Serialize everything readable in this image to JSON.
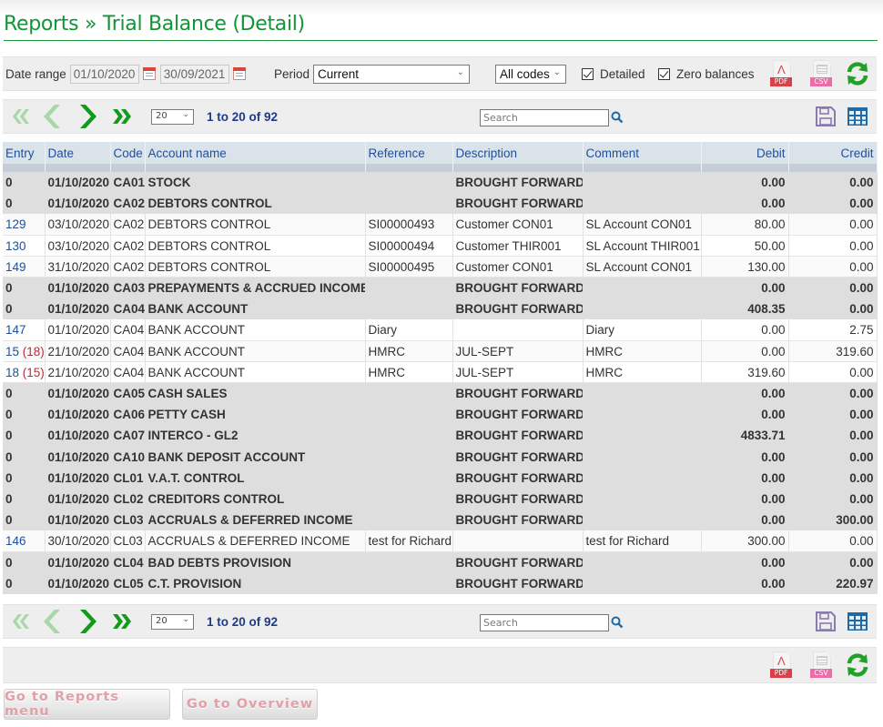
{
  "page": {
    "title": "Reports » Trial Balance (Detail)"
  },
  "filters": {
    "date_range_label": "Date range",
    "date_from": "01/10/2020",
    "date_to": "30/09/2021",
    "period_label": "Period",
    "period_value": "Current",
    "codes_value": "All codes",
    "detailed_label": "Detailed",
    "detailed_checked": true,
    "zero_balances_label": "Zero balances",
    "zero_balances_checked": true,
    "pdf_label": "PDF",
    "csv_label": "CSV"
  },
  "pager": {
    "page_size": "20",
    "count_text": "1 to 20 of 92",
    "search_placeholder": "Search"
  },
  "colors": {
    "brand_green": "#13943a",
    "header_blue": "#1f4f9a",
    "pdf_red": "#d6424c",
    "csv_pink": "#e86ea8"
  },
  "table": {
    "columns": [
      "Entry",
      "Date",
      "Code",
      "Account name",
      "Reference",
      "Description",
      "Comment",
      "Debit",
      "Credit"
    ],
    "rows": [
      {
        "type": "bf",
        "entry": "0",
        "entry_ref": "",
        "date": "01/10/2020",
        "code": "CA01",
        "account": "STOCK",
        "reference": "",
        "description": "BROUGHT FORWARD",
        "comment": "",
        "debit": "0.00",
        "credit": "0.00"
      },
      {
        "type": "bf",
        "entry": "0",
        "entry_ref": "",
        "date": "01/10/2020",
        "code": "CA02",
        "account": "DEBTORS CONTROL",
        "reference": "",
        "description": "BROUGHT FORWARD",
        "comment": "",
        "debit": "0.00",
        "credit": "0.00"
      },
      {
        "type": "tx",
        "entry": "129",
        "entry_ref": "",
        "date": "03/10/2020",
        "code": "CA02",
        "account": "DEBTORS CONTROL",
        "reference": "SI00000493",
        "description": "Customer CON01",
        "comment": "SL Account CON01",
        "debit": "80.00",
        "credit": "0.00"
      },
      {
        "type": "tx",
        "entry": "130",
        "entry_ref": "",
        "date": "03/10/2020",
        "code": "CA02",
        "account": "DEBTORS CONTROL",
        "reference": "SI00000494",
        "description": "Customer THIR001",
        "comment": "SL Account THIR001",
        "debit": "50.00",
        "credit": "0.00"
      },
      {
        "type": "tx",
        "entry": "149",
        "entry_ref": "",
        "date": "31/10/2020",
        "code": "CA02",
        "account": "DEBTORS CONTROL",
        "reference": "SI00000495",
        "description": "Customer CON01",
        "comment": "SL Account CON01",
        "debit": "130.00",
        "credit": "0.00"
      },
      {
        "type": "bf",
        "entry": "0",
        "entry_ref": "",
        "date": "01/10/2020",
        "code": "CA03",
        "account": "PREPAYMENTS & ACCRUED INCOME",
        "reference": "",
        "description": "BROUGHT FORWARD",
        "comment": "",
        "debit": "0.00",
        "credit": "0.00"
      },
      {
        "type": "bf",
        "entry": "0",
        "entry_ref": "",
        "date": "01/10/2020",
        "code": "CA04",
        "account": "BANK ACCOUNT",
        "reference": "",
        "description": "BROUGHT FORWARD",
        "comment": "",
        "debit": "408.35",
        "credit": "0.00"
      },
      {
        "type": "tx",
        "entry": "147",
        "entry_ref": "",
        "date": "01/10/2020",
        "code": "CA04",
        "account": "BANK ACCOUNT",
        "reference": "Diary",
        "description": "",
        "comment": "Diary",
        "debit": "0.00",
        "credit": "2.75"
      },
      {
        "type": "tx",
        "entry": "15",
        "entry_ref": "(18)",
        "date": "21/10/2020",
        "code": "CA04",
        "account": "BANK ACCOUNT",
        "reference": "HMRC",
        "description": "JUL-SEPT",
        "comment": "HMRC",
        "debit": "0.00",
        "credit": "319.60"
      },
      {
        "type": "tx",
        "entry": "18",
        "entry_ref": "(15)",
        "date": "21/10/2020",
        "code": "CA04",
        "account": "BANK ACCOUNT",
        "reference": "HMRC",
        "description": "JUL-SEPT",
        "comment": "HMRC",
        "debit": "319.60",
        "credit": "0.00"
      },
      {
        "type": "bf",
        "entry": "0",
        "entry_ref": "",
        "date": "01/10/2020",
        "code": "CA05",
        "account": "CASH SALES",
        "reference": "",
        "description": "BROUGHT FORWARD",
        "comment": "",
        "debit": "0.00",
        "credit": "0.00"
      },
      {
        "type": "bf",
        "entry": "0",
        "entry_ref": "",
        "date": "01/10/2020",
        "code": "CA06",
        "account": "PETTY CASH",
        "reference": "",
        "description": "BROUGHT FORWARD",
        "comment": "",
        "debit": "0.00",
        "credit": "0.00"
      },
      {
        "type": "bf",
        "entry": "0",
        "entry_ref": "",
        "date": "01/10/2020",
        "code": "CA07",
        "account": "INTERCO - GL2",
        "reference": "",
        "description": "BROUGHT FORWARD",
        "comment": "",
        "debit": "4833.71",
        "credit": "0.00"
      },
      {
        "type": "bf",
        "entry": "0",
        "entry_ref": "",
        "date": "01/10/2020",
        "code": "CA10",
        "account": "BANK DEPOSIT ACCOUNT",
        "reference": "",
        "description": "BROUGHT FORWARD",
        "comment": "",
        "debit": "0.00",
        "credit": "0.00"
      },
      {
        "type": "bf",
        "entry": "0",
        "entry_ref": "",
        "date": "01/10/2020",
        "code": "CL01",
        "account": "V.A.T. CONTROL",
        "reference": "",
        "description": "BROUGHT FORWARD",
        "comment": "",
        "debit": "0.00",
        "credit": "0.00"
      },
      {
        "type": "bf",
        "entry": "0",
        "entry_ref": "",
        "date": "01/10/2020",
        "code": "CL02",
        "account": "CREDITORS CONTROL",
        "reference": "",
        "description": "BROUGHT FORWARD",
        "comment": "",
        "debit": "0.00",
        "credit": "0.00"
      },
      {
        "type": "bf",
        "entry": "0",
        "entry_ref": "",
        "date": "01/10/2020",
        "code": "CL03",
        "account": "ACCRUALS & DEFERRED INCOME",
        "reference": "",
        "description": "BROUGHT FORWARD",
        "comment": "",
        "debit": "0.00",
        "credit": "300.00"
      },
      {
        "type": "tx",
        "entry": "146",
        "entry_ref": "",
        "date": "30/10/2020",
        "code": "CL03",
        "account": "ACCRUALS & DEFERRED INCOME",
        "reference": "test for Richard",
        "description": "",
        "comment": "test for Richard",
        "debit": "300.00",
        "credit": "0.00"
      },
      {
        "type": "bf",
        "entry": "0",
        "entry_ref": "",
        "date": "01/10/2020",
        "code": "CL04",
        "account": "BAD DEBTS PROVISION",
        "reference": "",
        "description": "BROUGHT FORWARD",
        "comment": "",
        "debit": "0.00",
        "credit": "0.00"
      },
      {
        "type": "bf",
        "entry": "0",
        "entry_ref": "",
        "date": "01/10/2020",
        "code": "CL05",
        "account": "C.T. PROVISION",
        "reference": "",
        "description": "BROUGHT FORWARD",
        "comment": "",
        "debit": "0.00",
        "credit": "220.97"
      }
    ]
  },
  "footer": {
    "reports_menu_button": "Go to Reports menu",
    "overview_button": "Go to Overview"
  }
}
